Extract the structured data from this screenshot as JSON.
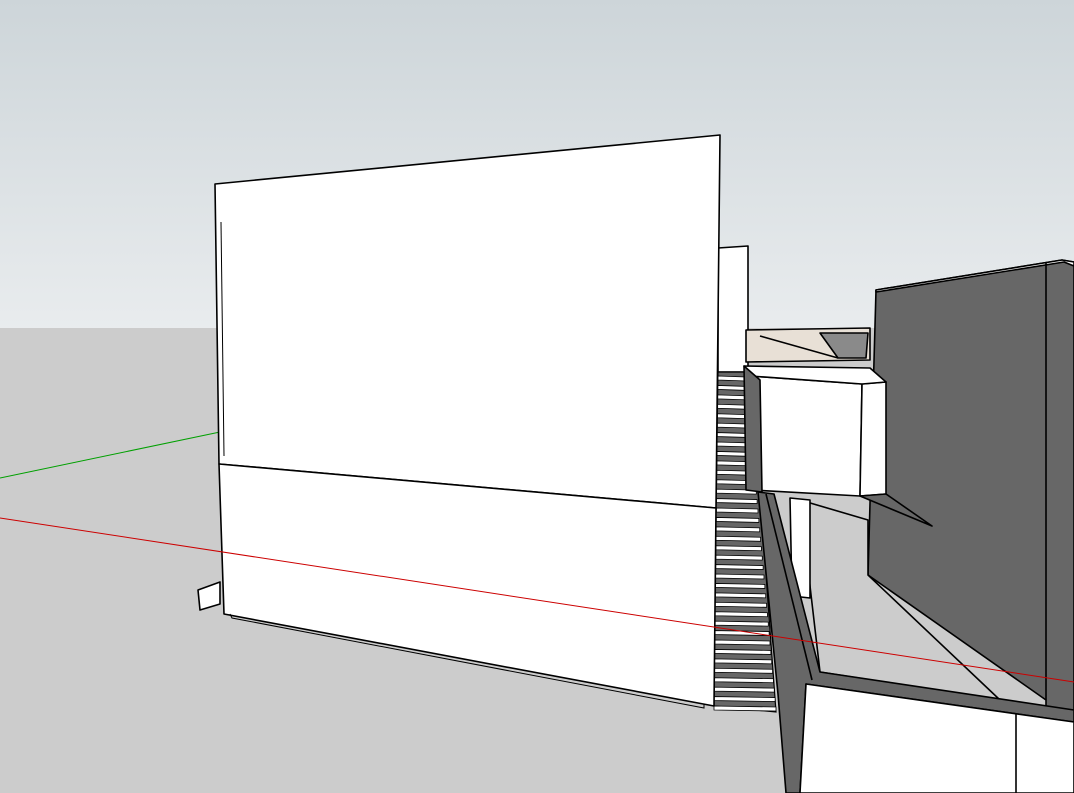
{
  "viewport": {
    "colors": {
      "sky_top": "#cdd5d9",
      "sky_bottom": "#e9ecee",
      "ground": "#cccccc",
      "face_light": "#ffffff",
      "face_shadow": "#676767",
      "face_mid": "#8a8a8a",
      "face_beige": "#e8e0d6",
      "edge": "#000000",
      "axis_red": "#cc0000",
      "axis_green": "#00a000"
    }
  }
}
